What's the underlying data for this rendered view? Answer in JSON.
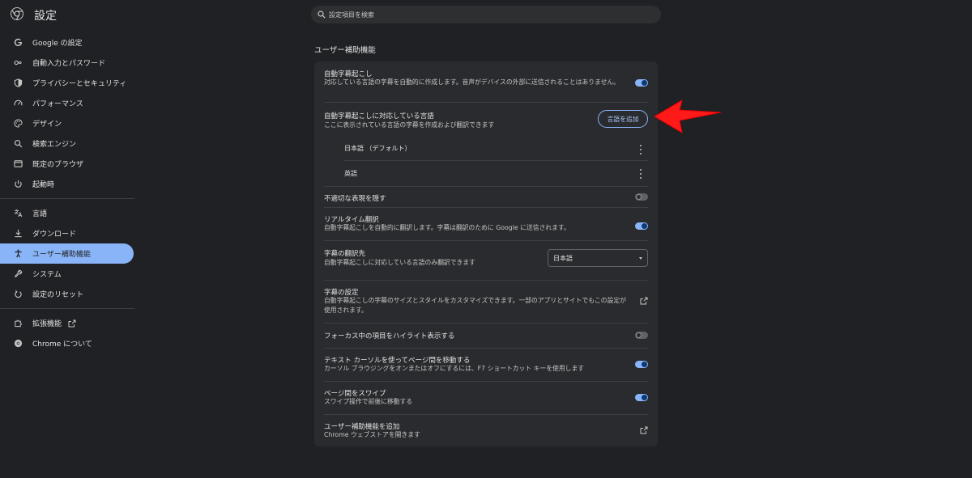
{
  "header": {
    "app_title": "設定",
    "search_placeholder": "設定項目を検索"
  },
  "sidebar": {
    "items": [
      {
        "label": "Google の設定",
        "icon": "google-g-icon"
      },
      {
        "label": "自動入力とパスワード",
        "icon": "key-icon"
      },
      {
        "label": "プライバシーとセキュリティ",
        "icon": "shield-icon"
      },
      {
        "label": "パフォーマンス",
        "icon": "speedometer-icon"
      },
      {
        "label": "デザイン",
        "icon": "palette-icon"
      },
      {
        "label": "検索エンジン",
        "icon": "search-icon"
      },
      {
        "label": "既定のブラウザ",
        "icon": "browser-window-icon"
      },
      {
        "label": "起動時",
        "icon": "power-icon"
      },
      {
        "label": "言語",
        "icon": "translate-icon"
      },
      {
        "label": "ダウンロード",
        "icon": "download-icon"
      },
      {
        "label": "ユーザー補助機能",
        "icon": "accessibility-icon",
        "active": true
      },
      {
        "label": "システム",
        "icon": "wrench-icon"
      },
      {
        "label": "設定のリセット",
        "icon": "reset-icon"
      },
      {
        "label": "拡張機能",
        "icon": "puzzle-icon"
      },
      {
        "label": "Chrome について",
        "icon": "chrome-icon"
      }
    ]
  },
  "main": {
    "section_title": "ユーザー補助機能",
    "live_caption": {
      "title": "自動字幕起こし",
      "desc": "対応している言語の字幕を自動的に作成します。音声がデバイスの外部に送信されることはありません。",
      "enabled": true
    },
    "caption_languages": {
      "title": "自動字幕起こしに対応している言語",
      "desc": "ここに表示されている言語の字幕を作成および翻訳できます",
      "add_button": "言語を追加",
      "languages": [
        "日本語 （デフォルト）",
        "英語"
      ]
    },
    "profanity": {
      "title": "不適切な表現を隠す",
      "enabled": false
    },
    "live_translate": {
      "title": "リアルタイム翻訳",
      "desc": "自動字幕起こしを自動的に翻訳します。字幕は翻訳のために Google に送信されます。",
      "enabled": true
    },
    "translate_target": {
      "title": "字幕の翻訳先",
      "desc": "自動字幕起こしに対応している言語のみ翻訳できます",
      "selected": "日本語"
    },
    "caption_settings": {
      "title": "字幕の設定",
      "desc": "自動字幕起こしの字幕のサイズとスタイルをカスタマイズできます。一部のアプリとサイトでもこの設定が使用されます。"
    },
    "focus_highlight": {
      "title": "フォーカス中の項目をハイライト表示する",
      "enabled": false
    },
    "caret_browsing": {
      "title": "テキスト カーソルを使ってページ間を移動する",
      "desc": "カーソル ブラウジングをオンまたはオフにするには、F7 ショートカット キーを使用します",
      "enabled": true
    },
    "swipe_nav": {
      "title": "ページ間をスワイプ",
      "desc": "スワイプ操作で前後に移動する",
      "enabled": true
    },
    "add_features": {
      "title": "ユーザー補助機能を追加",
      "desc": "Chrome ウェブストアを開きます"
    }
  },
  "colors": {
    "background": "#202124",
    "card": "#2a2b2e",
    "accent": "#8ab4f8",
    "annotation_arrow": "#ff0000"
  }
}
